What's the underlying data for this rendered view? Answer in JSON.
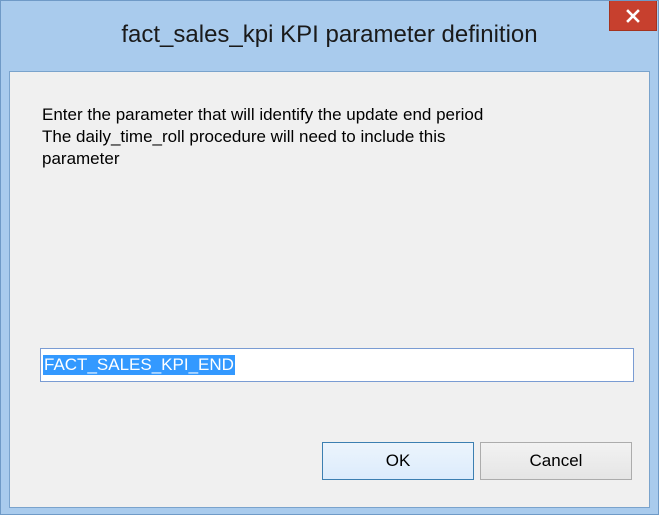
{
  "window": {
    "title": "fact_sales_kpi KPI parameter definition",
    "close_icon": "close-icon"
  },
  "dialog": {
    "message_lines": [
      "Enter the parameter that will identify the update end period",
      "The daily_time_roll procedure will need to include this",
      "parameter"
    ],
    "parameter_value": "FACT_SALES_KPI_END",
    "ok_label": "OK",
    "cancel_label": "Cancel"
  },
  "colors": {
    "frame": "#a9cbed",
    "close_button": "#c7402e",
    "client_background": "#f0f0f0",
    "selection": "#3399ff"
  }
}
